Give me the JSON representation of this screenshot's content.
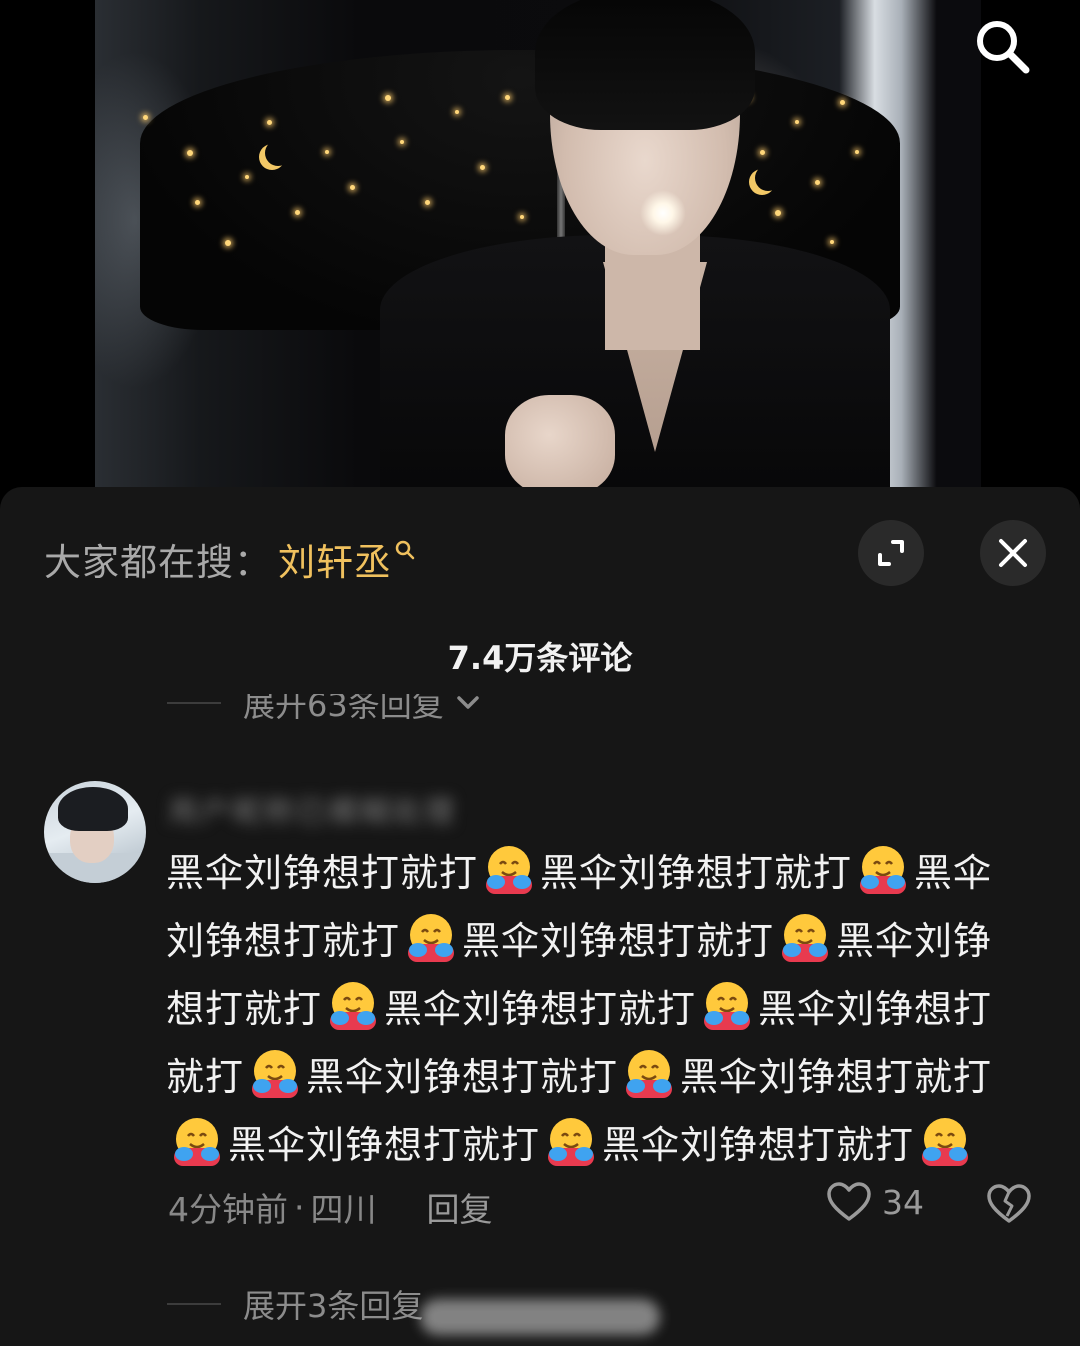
{
  "colors": {
    "sheet_bg": "#161616",
    "keyword": "#f0c15e",
    "muted_text": "#888888",
    "primary_text": "#f2f2f2"
  },
  "video": {
    "search_icon": "search-icon"
  },
  "header": {
    "trending_label": "大家都在搜：",
    "trending_keyword": "刘轩丞",
    "keyword_icon": "search-small-icon",
    "expand_icon": "expand-icon",
    "close_icon": "close-icon"
  },
  "comments": {
    "count_text": "7.4万条评论",
    "previous_replies_text": "展开63条回复",
    "items": [
      {
        "username": "用户昵称已模糊处理",
        "text_parts": [
          "黑伞刘铮想打就打",
          "黑伞刘铮想打就打",
          "黑伞刘铮想打就打",
          "黑伞刘铮想打就打",
          "黑伞刘铮想打就打",
          "黑伞刘铮想打就打",
          "黑伞刘铮想打就打",
          "黑伞刘铮想打就打",
          "黑伞刘铮想打就打",
          "黑伞刘铮想打就打",
          "黑伞刘铮想打就打"
        ],
        "emoji": "hugging-face-emoji",
        "time": "4分钟前",
        "separator": "·",
        "location": "四川",
        "reply_label": "回复",
        "like_count": "34",
        "more_replies_text": "展开3条回复"
      }
    ]
  }
}
